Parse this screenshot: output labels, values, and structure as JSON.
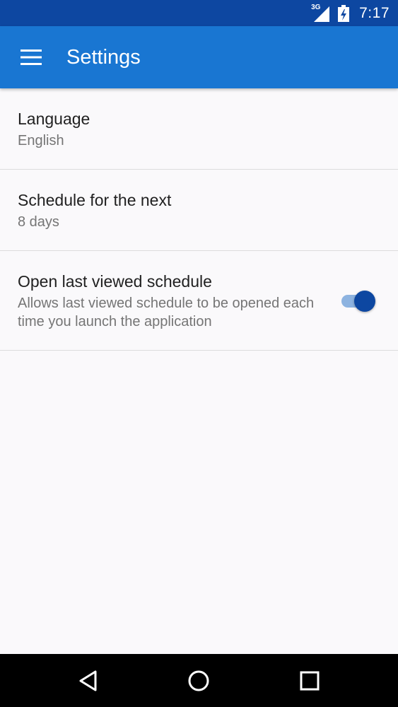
{
  "status_bar": {
    "network_label": "3G",
    "time": "7:17",
    "icons": [
      "signal-icon",
      "battery-icon"
    ]
  },
  "app_bar": {
    "title": "Settings",
    "menu_icon": "menu-icon",
    "color": "#1976d2"
  },
  "preferences": [
    {
      "title": "Language",
      "summary": "English"
    },
    {
      "title": "Schedule for the next",
      "summary": "8 days"
    },
    {
      "title": "Open last viewed schedule",
      "summary": "Allows last viewed schedule to be opened each time you launch the application",
      "toggle_on": true
    }
  ],
  "nav_bar": {
    "icons": [
      "back-icon",
      "home-icon",
      "recents-icon"
    ]
  },
  "colors": {
    "status_bar": "#0d47a1",
    "accent": "#0d47a1",
    "background": "#faf9fb"
  }
}
